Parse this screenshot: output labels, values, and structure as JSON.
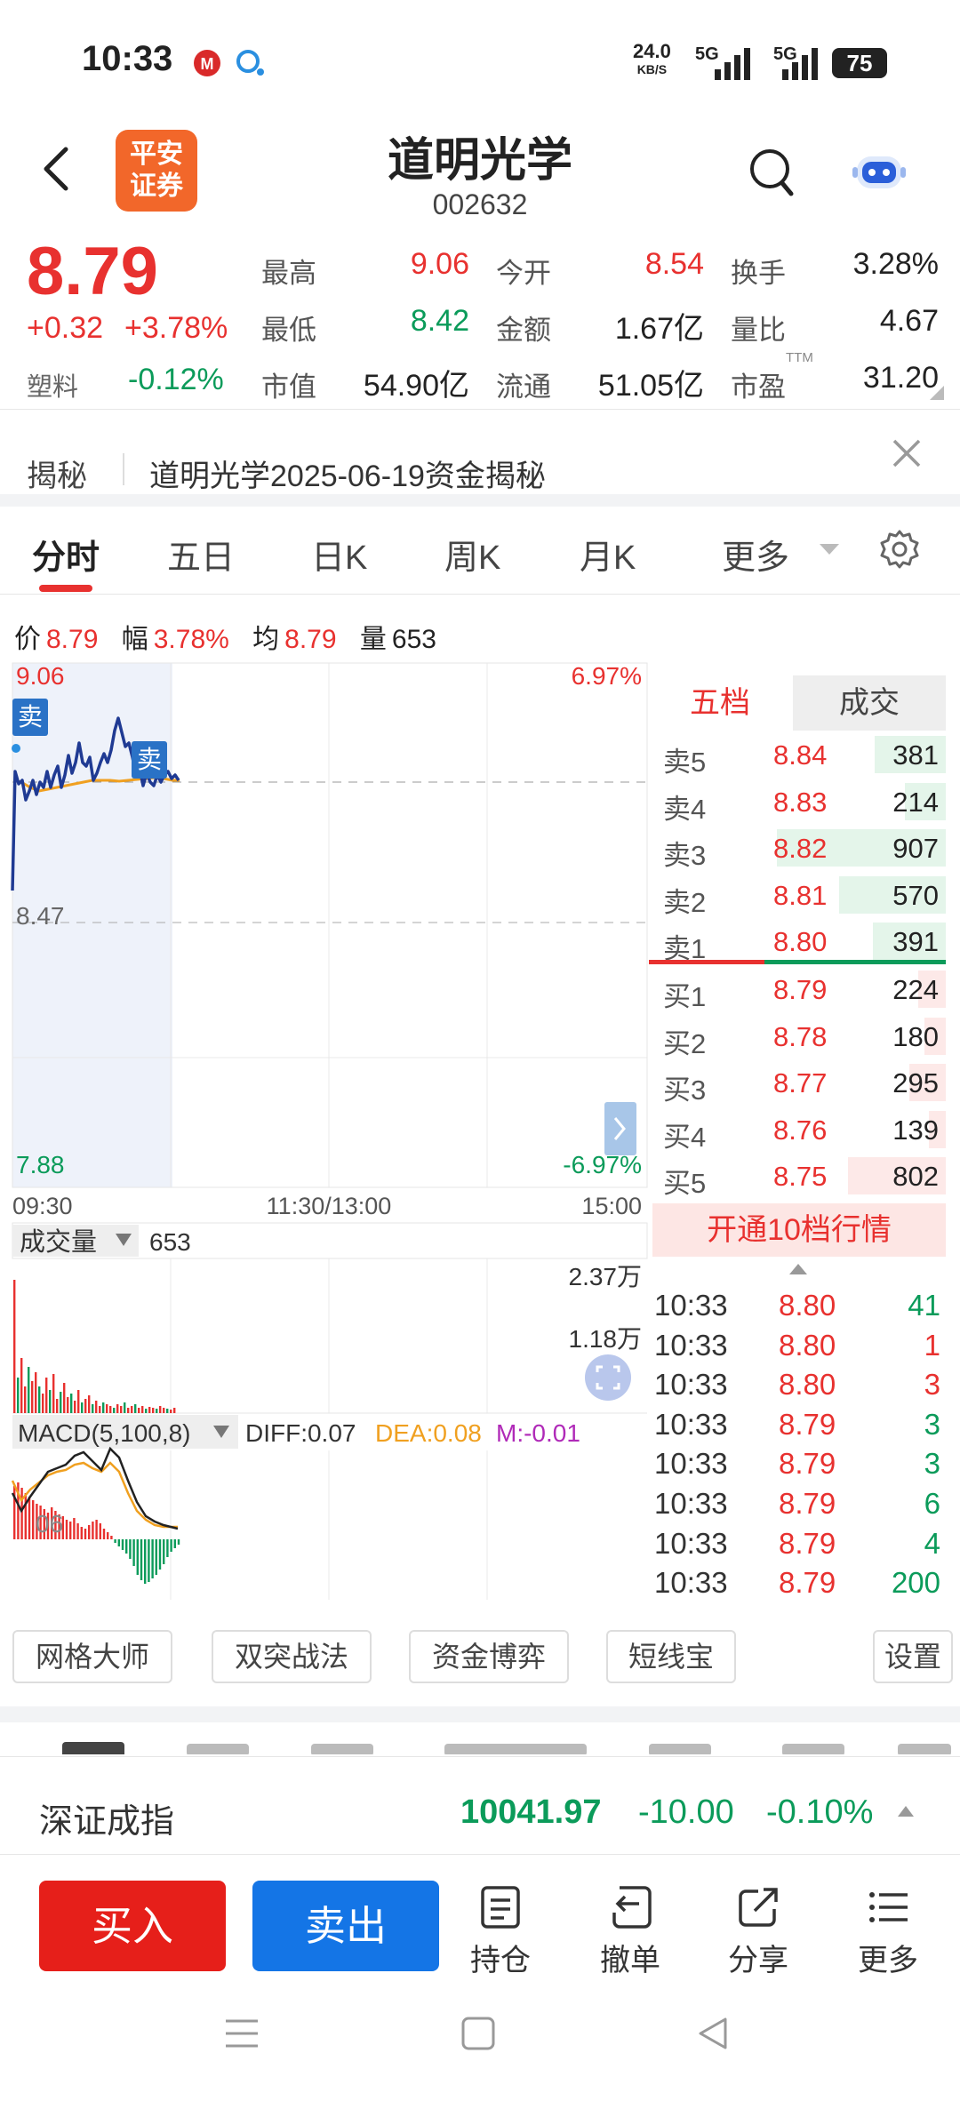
{
  "status_bar": {
    "time": "10:33",
    "speed_value": "24.0",
    "speed_unit": "KB/S",
    "network1": "5G",
    "network2": "5G",
    "battery": "75"
  },
  "header": {
    "logo_line1": "平安",
    "logo_line2": "证券",
    "title": "道明光学",
    "code": "002632"
  },
  "quote": {
    "price": "8.79",
    "change": "+0.32",
    "change_pct": "+3.78%",
    "sector_label": "塑料",
    "sector_value": "-0.12%",
    "fields": [
      {
        "label": "最高",
        "value": "9.06"
      },
      {
        "label": "今开",
        "value": "8.54"
      },
      {
        "label": "换手",
        "value": "3.28%"
      },
      {
        "label": "最低",
        "value": "8.42"
      },
      {
        "label": "金额",
        "value": "1.67亿"
      },
      {
        "label": "量比",
        "value": "4.67"
      },
      {
        "label": "市值",
        "value": "54.90亿"
      },
      {
        "label": "流通",
        "value": "51.05亿"
      },
      {
        "label": "市盈",
        "value": "31.20"
      }
    ],
    "pe_superscript": "TTM"
  },
  "reveal": {
    "label": "揭秘",
    "text": "道明光学2025-06-19资金揭秘"
  },
  "tabs": [
    "分时",
    "五日",
    "日K",
    "周K",
    "月K",
    "更多"
  ],
  "info_row": {
    "price_label": "价",
    "price": "8.79",
    "range_label": "幅",
    "range": "3.78%",
    "avg_label": "均",
    "avg": "8.79",
    "vol_label": "量",
    "vol": "653"
  },
  "chart": {
    "y_max": "9.06",
    "y_mid": "8.47",
    "y_min": "7.88",
    "pct_max": "6.97%",
    "pct_min": "-6.97%",
    "sell_badge": "卖",
    "time_start": "09:30",
    "time_mid": "11:30/13:00",
    "time_end": "15:00",
    "volume_label": "成交量",
    "volume_value": "653",
    "vol_axis_1": "2.37万",
    "vol_axis_2": "1.18万",
    "macd_label": "MACD(5,100,8)",
    "diff": "DIFF:0.07",
    "dea": "DEA:0.08",
    "m": "M:-0.01",
    "macd_axis": "06",
    "colors": {
      "price_line": "#1f3a93",
      "avg_line": "#f0a020",
      "up": "#e8312f",
      "down": "#0b9b5a"
    }
  },
  "order_book": {
    "tab_active": "五档",
    "tab_other": "成交",
    "asks": [
      {
        "label": "卖5",
        "price": "8.84",
        "volume": "381",
        "fill": 0.42
      },
      {
        "label": "卖4",
        "price": "8.83",
        "volume": "214",
        "fill": 0.24
      },
      {
        "label": "卖3",
        "price": "8.82",
        "volume": "907",
        "fill": 1.0
      },
      {
        "label": "卖2",
        "price": "8.81",
        "volume": "570",
        "fill": 0.63
      },
      {
        "label": "卖1",
        "price": "8.80",
        "volume": "391",
        "fill": 0.43
      }
    ],
    "bids": [
      {
        "label": "买1",
        "price": "8.79",
        "volume": "224",
        "fill": 0.28
      },
      {
        "label": "买2",
        "price": "8.78",
        "volume": "180",
        "fill": 0.22
      },
      {
        "label": "买3",
        "price": "8.77",
        "volume": "295",
        "fill": 0.37
      },
      {
        "label": "买4",
        "price": "8.76",
        "volume": "139",
        "fill": 0.17
      },
      {
        "label": "买5",
        "price": "8.75",
        "volume": "802",
        "fill": 1.0
      }
    ],
    "open_level10": "开通10档行情"
  },
  "ticks": [
    {
      "time": "10:33",
      "price": "8.80",
      "volume": "41",
      "dir": "down"
    },
    {
      "time": "10:33",
      "price": "8.80",
      "volume": "1",
      "dir": "up"
    },
    {
      "time": "10:33",
      "price": "8.80",
      "volume": "3",
      "dir": "up"
    },
    {
      "time": "10:33",
      "price": "8.79",
      "volume": "3",
      "dir": "down"
    },
    {
      "time": "10:33",
      "price": "8.79",
      "volume": "3",
      "dir": "down"
    },
    {
      "time": "10:33",
      "price": "8.79",
      "volume": "6",
      "dir": "down"
    },
    {
      "time": "10:33",
      "price": "8.79",
      "volume": "4",
      "dir": "down"
    },
    {
      "time": "10:33",
      "price": "8.79",
      "volume": "200",
      "dir": "down"
    }
  ],
  "tools": [
    "网格大师",
    "双突战法",
    "资金博弈",
    "短线宝",
    "设置"
  ],
  "index_bar": {
    "name": "深证成指",
    "value": "10041.97",
    "change": "-10.00",
    "change_pct": "-0.10%"
  },
  "bottom": {
    "buy": "买入",
    "sell": "卖出",
    "hold": "持仓",
    "cancel": "撤单",
    "share": "分享",
    "more": "更多"
  }
}
